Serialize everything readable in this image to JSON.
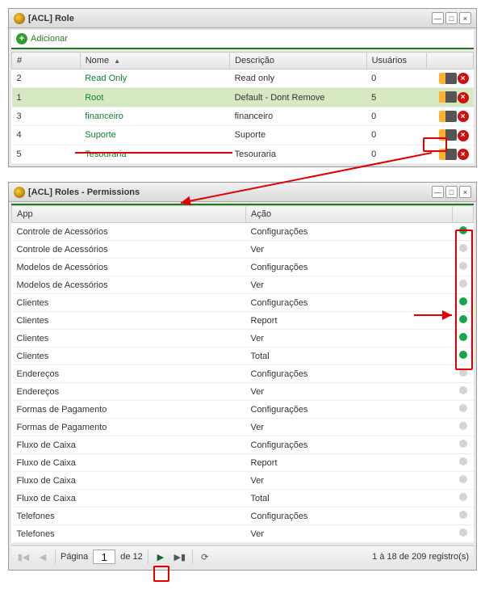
{
  "role_panel": {
    "title": "[ACL] Role",
    "add_label": "Adicionar",
    "columns": {
      "hash": "#",
      "nome": "Nome",
      "sort_arrow": "▲",
      "descricao": "Descrição",
      "usuarios": "Usuários"
    },
    "rows": [
      {
        "id": "2",
        "nome": "Read Only",
        "desc": "Read only",
        "users": "0",
        "selected": false
      },
      {
        "id": "1",
        "nome": "Root",
        "desc": "Default - Dont Remove",
        "users": "5",
        "selected": true
      },
      {
        "id": "3",
        "nome": "financeiro",
        "desc": "financeiro",
        "users": "0",
        "selected": false
      },
      {
        "id": "4",
        "nome": "Suporte",
        "desc": "Suporte",
        "users": "0",
        "selected": false
      },
      {
        "id": "5",
        "nome": "Tesouraria",
        "desc": "Tesouraria",
        "users": "0",
        "selected": false
      }
    ]
  },
  "perm_panel": {
    "title": "[ACL] Roles - Permissions",
    "columns": {
      "app": "App",
      "acao": "Ação"
    },
    "rows": [
      {
        "app": "Controle de Acessórios",
        "acao": "Configurações",
        "on": true
      },
      {
        "app": "Controle de Acessórios",
        "acao": "Ver",
        "on": false
      },
      {
        "app": "Modelos de Acessórios",
        "acao": "Configurações",
        "on": false
      },
      {
        "app": "Modelos de Acessórios",
        "acao": "Ver",
        "on": false
      },
      {
        "app": "Clientes",
        "acao": "Configurações",
        "on": true
      },
      {
        "app": "Clientes",
        "acao": "Report",
        "on": true
      },
      {
        "app": "Clientes",
        "acao": "Ver",
        "on": true
      },
      {
        "app": "Clientes",
        "acao": "Total",
        "on": true
      },
      {
        "app": "Endereços",
        "acao": "Configurações",
        "on": false
      },
      {
        "app": "Endereços",
        "acao": "Ver",
        "on": false
      },
      {
        "app": "Formas de Pagamento",
        "acao": "Configurações",
        "on": false
      },
      {
        "app": "Formas de Pagamento",
        "acao": "Ver",
        "on": false
      },
      {
        "app": "Fluxo de Caixa",
        "acao": "Configurações",
        "on": false
      },
      {
        "app": "Fluxo de Caixa",
        "acao": "Report",
        "on": false
      },
      {
        "app": "Fluxo de Caixa",
        "acao": "Ver",
        "on": false
      },
      {
        "app": "Fluxo de Caixa",
        "acao": "Total",
        "on": false
      },
      {
        "app": "Telefones",
        "acao": "Configurações",
        "on": false
      },
      {
        "app": "Telefones",
        "acao": "Ver",
        "on": false
      }
    ],
    "pager": {
      "label_pagina": "Página",
      "current": "1",
      "label_de": "de 12",
      "status": "1 à 18 de 209 registro(s)"
    }
  },
  "icons": {
    "minimize": "—",
    "maximize": "□",
    "close": "×",
    "first": "▮◀",
    "prev": "◀",
    "next": "▶",
    "last": "▶▮",
    "refresh": "⟳"
  }
}
